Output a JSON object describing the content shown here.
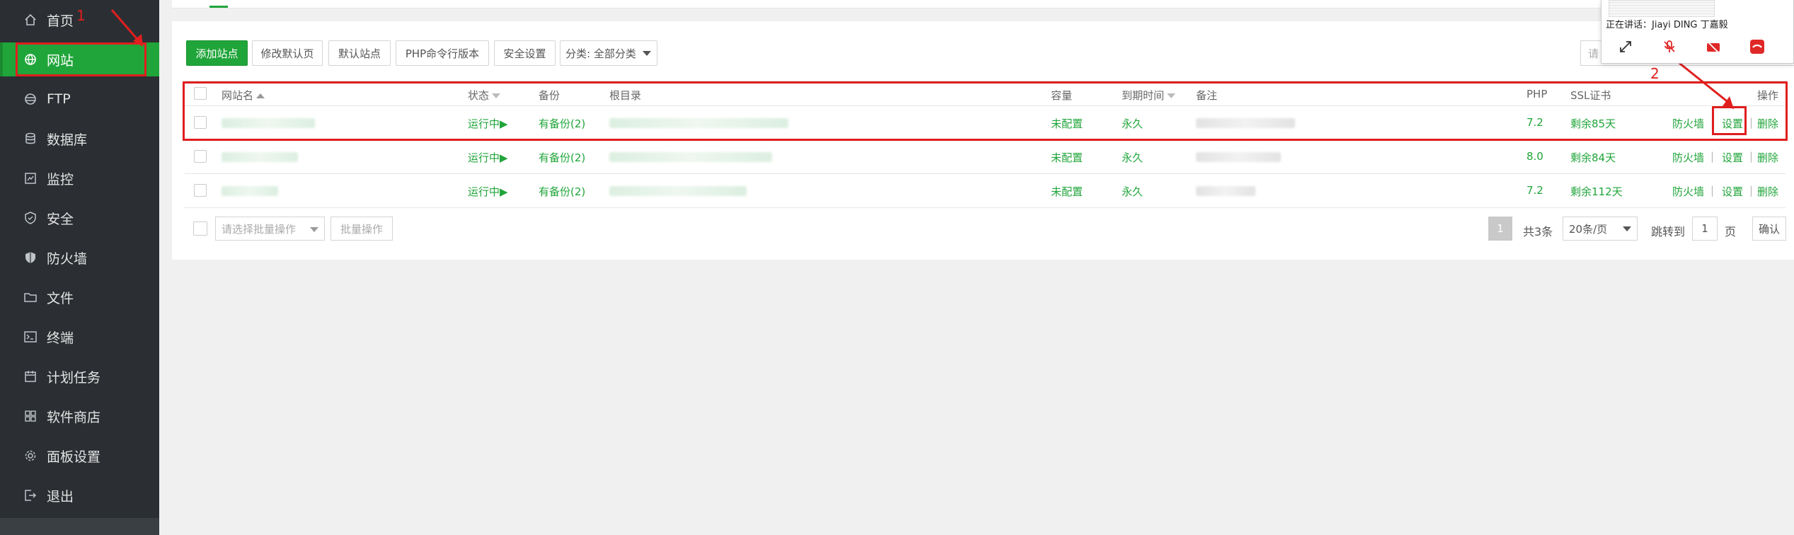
{
  "sidebar": {
    "items": [
      {
        "label": "首页",
        "icon": "home-icon"
      },
      {
        "label": "网站",
        "icon": "globe-icon"
      },
      {
        "label": "FTP",
        "icon": "ftp-icon"
      },
      {
        "label": "数据库",
        "icon": "database-icon"
      },
      {
        "label": "监控",
        "icon": "monitor-icon"
      },
      {
        "label": "安全",
        "icon": "shield-icon"
      },
      {
        "label": "防火墙",
        "icon": "firewall-icon"
      },
      {
        "label": "文件",
        "icon": "folder-icon"
      },
      {
        "label": "终端",
        "icon": "terminal-icon"
      },
      {
        "label": "计划任务",
        "icon": "calendar-icon"
      },
      {
        "label": "软件商店",
        "icon": "apps-icon"
      },
      {
        "label": "面板设置",
        "icon": "gear-icon"
      },
      {
        "label": "退出",
        "icon": "logout-icon"
      }
    ],
    "active": "网站"
  },
  "toolbar": {
    "add_site": "添加站点",
    "edit_default_page": "修改默认页",
    "default_site": "默认站点",
    "php_cli_version": "PHP命令行版本",
    "security_settings": "安全设置",
    "category": "分类: 全部分类",
    "search_placeholder": "请"
  },
  "table": {
    "headers": {
      "site_name": "网站名",
      "status": "状态",
      "backup": "备份",
      "root_dir": "根目录",
      "capacity": "容量",
      "expire": "到期时间",
      "note": "备注",
      "php": "PHP",
      "ssl": "SSL证书",
      "actions": "操作"
    },
    "rows": [
      {
        "status": "运行中▶",
        "backup": "有备份(2)",
        "capacity": "未配置",
        "expire": "永久",
        "php": "7.2",
        "ssl": "剩余85天",
        "firewall": "防火墙",
        "settings": "设置",
        "delete": "删除"
      },
      {
        "status": "运行中▶",
        "backup": "有备份(2)",
        "capacity": "未配置",
        "expire": "永久",
        "php": "8.0",
        "ssl": "剩余84天",
        "firewall": "防火墙",
        "settings": "设置",
        "delete": "删除"
      },
      {
        "status": "运行中▶",
        "backup": "有备份(2)",
        "capacity": "未配置",
        "expire": "永久",
        "php": "7.2",
        "ssl": "剩余112天",
        "firewall": "防火墙",
        "settings": "设置",
        "delete": "删除"
      }
    ],
    "separator": "|"
  },
  "footer": {
    "batch_select_placeholder": "请选择批量操作",
    "batch_button": "批量操作",
    "current_page": "1",
    "total": "共3条",
    "page_size": "20条/页",
    "jump_to": "跳转到",
    "jump_value": "1",
    "page_unit": "页",
    "confirm": "确认"
  },
  "annotations": {
    "step1": "1",
    "step2": "2"
  },
  "meeting": {
    "speaking_text": "正在讲话：Jiayi DING 丁嘉毅"
  },
  "colors": {
    "accent": "#20a53a",
    "sidebar_bg": "#2b2f33",
    "annotation_red": "#e01e1e"
  }
}
